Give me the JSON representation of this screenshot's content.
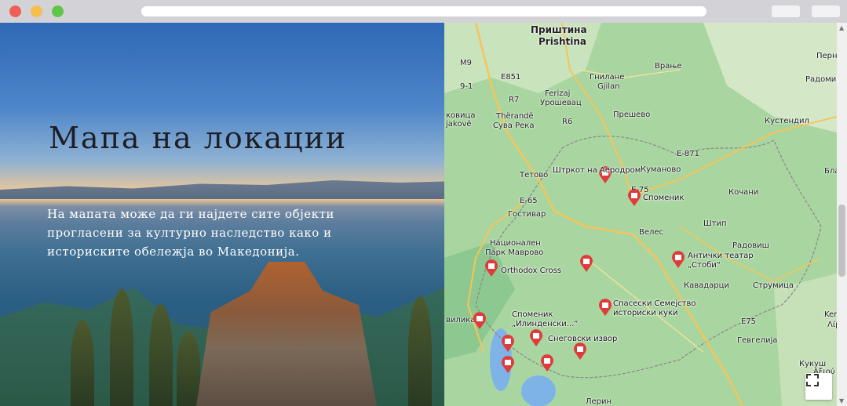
{
  "window": {
    "url": ""
  },
  "hero": {
    "title": "Мапа на локации",
    "description": "На мапата може да ги најдете сите објекти прогласени за културно наследство како и историските обележја во Македонија."
  },
  "map": {
    "places": [
      {
        "name": "Приштина",
        "sub": "Prishtina",
        "big": true
      },
      {
        "name": "M9"
      },
      {
        "name": "E851"
      },
      {
        "name": "9-1"
      },
      {
        "name": "R7"
      },
      {
        "name": "Гнилане",
        "sub": "Gjilan"
      },
      {
        "name": "Врање"
      },
      {
        "name": "Ferizaj",
        "sub": "Урошевац"
      },
      {
        "name": "Thërandë",
        "sub": "Сува Река"
      },
      {
        "name": "R6"
      },
      {
        "name": "Прешево"
      },
      {
        "name": "Куманово"
      },
      {
        "name": "E-75"
      },
      {
        "name": "E-871"
      },
      {
        "name": "Тетово"
      },
      {
        "name": "E-65"
      },
      {
        "name": "Гостивар"
      },
      {
        "name": "Велес"
      },
      {
        "name": "Штип"
      },
      {
        "name": "Кочани"
      },
      {
        "name": "Радовиш"
      },
      {
        "name": "Кавадарци"
      },
      {
        "name": "Струмица"
      },
      {
        "name": "Кустендил"
      },
      {
        "name": "Радомир"
      },
      {
        "name": "Перн"
      },
      {
        "name": "Гевгелија"
      },
      {
        "name": "Кукуш"
      },
      {
        "name": "Лерин"
      },
      {
        "name": "Ђакове",
        "sub": "jakovë"
      },
      {
        "name": "ковица"
      },
      {
        "name": "Национален",
        "sub": "Парк Маврово"
      },
      {
        "name": "вилика"
      },
      {
        "name": "Бла"
      },
      {
        "name": "Kerk"
      },
      {
        "name": "Λίμ"
      },
      {
        "name": "Αξιού"
      },
      {
        "name": "E75"
      }
    ],
    "markers": [
      {
        "label": "Штркот на Аеродром"
      },
      {
        "label": "Споменик"
      },
      {
        "label": "Orthodox Cross"
      },
      {
        "label": "Антички театар „Стоби“"
      },
      {
        "label": "Спасески Семејство историски куки"
      },
      {
        "label": "Споменик „Илинденски...“"
      },
      {
        "label": "Снеговски извор"
      },
      {
        "label": ""
      },
      {
        "label": ""
      },
      {
        "label": ""
      },
      {
        "label": ""
      },
      {
        "label": ""
      },
      {
        "label": ""
      }
    ],
    "colors": {
      "land": "#a9d6a0",
      "marker": "#e03a3a",
      "road": "#f5c55a",
      "water": "#7eb3e8"
    }
  }
}
